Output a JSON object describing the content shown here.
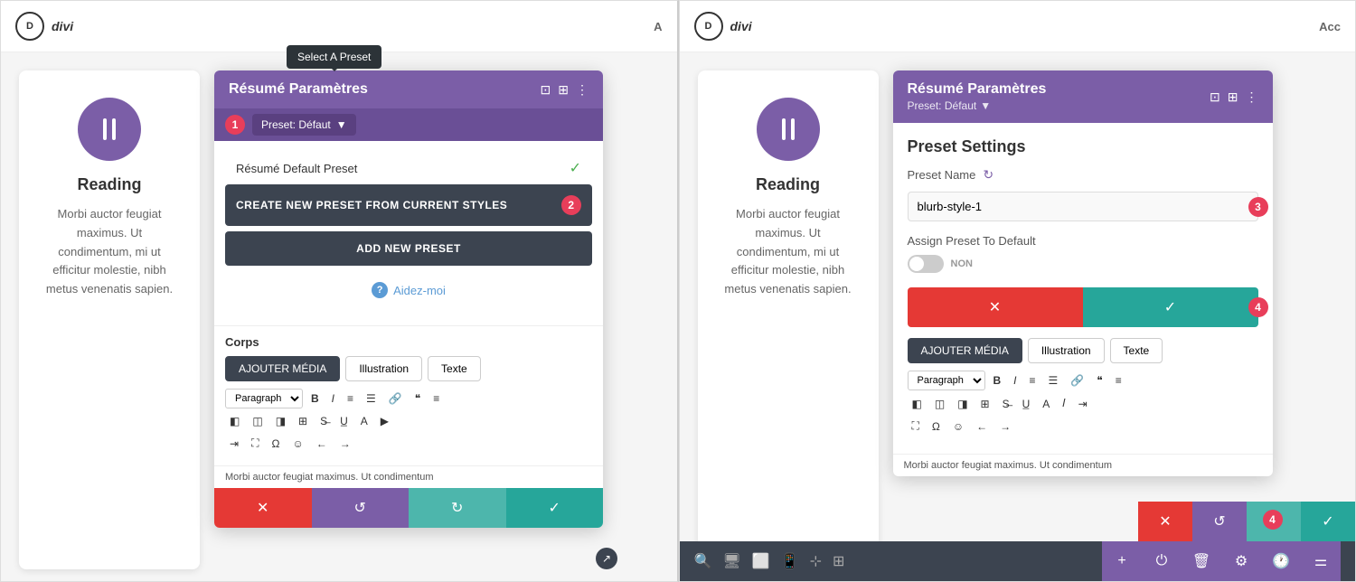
{
  "left_panel": {
    "logo": "D",
    "brand": "divi",
    "acc": "A",
    "card": {
      "title": "Reading",
      "body": "Morbi auctor feugiat maximus. Ut condimentum, mi ut efficitur molestie, nibh metus venenatis sapien."
    },
    "popup": {
      "title": "Résumé Paramètres",
      "preset_label": "Preset: Défaut",
      "tooltip": "Select A Preset",
      "preset_name": "Résumé Default Preset",
      "create_btn": "CREATE NEW PRESET FROM CURRENT STYLES",
      "add_btn": "ADD NEW PRESET",
      "help": "Aidez-moi",
      "corps_label": "Corps",
      "tab_media": "AJOUTER MÉDIA",
      "tab_illustration": "Illustration",
      "tab_texte": "Texte",
      "paragraph_label": "Paragraph",
      "text_preview": "Morbi auctor feugiat maximus. Ut condimentum"
    },
    "bottom_btns": {
      "cancel": "✕",
      "reset": "↺",
      "redo": "↻",
      "save": "✓"
    }
  },
  "right_panel": {
    "logo": "D",
    "brand": "divi",
    "acc": "Acc",
    "card": {
      "title": "Reading",
      "body": "Morbi auctor feugiat maximus. Ut condimentum, mi ut efficitur molestie, nibh metus venenatis sapien."
    },
    "popup": {
      "title": "Résumé Paramètres",
      "preset_label": "Preset: Défaut",
      "settings_title": "Preset Settings",
      "field_label": "Preset Name",
      "field_value": "blurb-style-1",
      "assign_label": "Assign Preset To Default",
      "toggle_label": "NON",
      "tab_media": "AJOUTER MÉDIA",
      "tab_illustration": "Illustration",
      "tab_texte": "Texte",
      "paragraph_label": "Paragraph",
      "text_preview": "Morbi auctor feugiat maximus. Ut condimentum"
    },
    "bottom_btns": {
      "cancel": "✕",
      "reset": "↺",
      "redo": "↻",
      "save": "✓"
    }
  },
  "badges": {
    "step1": "1",
    "step2": "2",
    "step3": "3",
    "step4": "4"
  },
  "colors": {
    "purple": "#7b5ea7",
    "red": "#e53935",
    "teal": "#26a69a",
    "dark": "#3c4450",
    "tooltip_bg": "#2c3338"
  }
}
